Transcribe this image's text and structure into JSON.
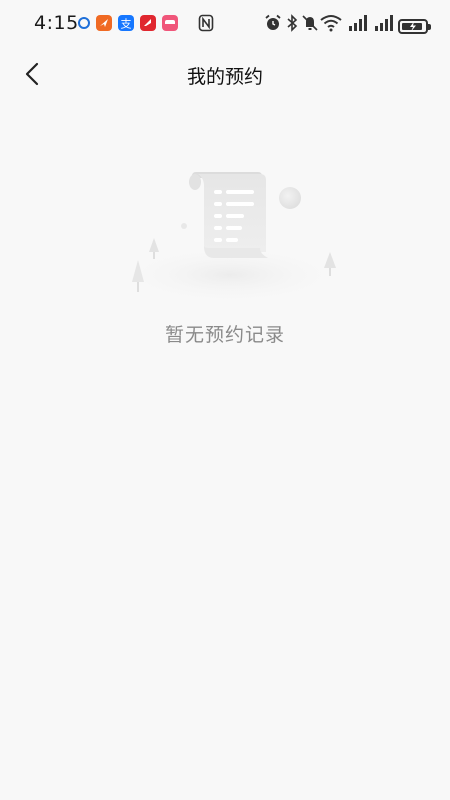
{
  "status_bar": {
    "time": "4:15",
    "notification_icons": [
      {
        "name": "location-app-icon",
        "color": "#1e6fd9"
      },
      {
        "name": "send-app-icon",
        "color": "#f06a23"
      },
      {
        "name": "alipay-icon",
        "color": "#1677ff"
      },
      {
        "name": "red-app-icon",
        "color": "#e0272f"
      },
      {
        "name": "pink-app-icon",
        "color": "#f0567a"
      }
    ],
    "battery_level": 0.9
  },
  "header": {
    "title": "我的预约",
    "back_icon": "chevron-left-icon"
  },
  "empty_state": {
    "message": "暂无预约记录",
    "illustration": "empty-document-illustration"
  },
  "colors": {
    "background": "#f8f8f8",
    "title_text": "#111111",
    "empty_text": "#8a8a8a"
  }
}
